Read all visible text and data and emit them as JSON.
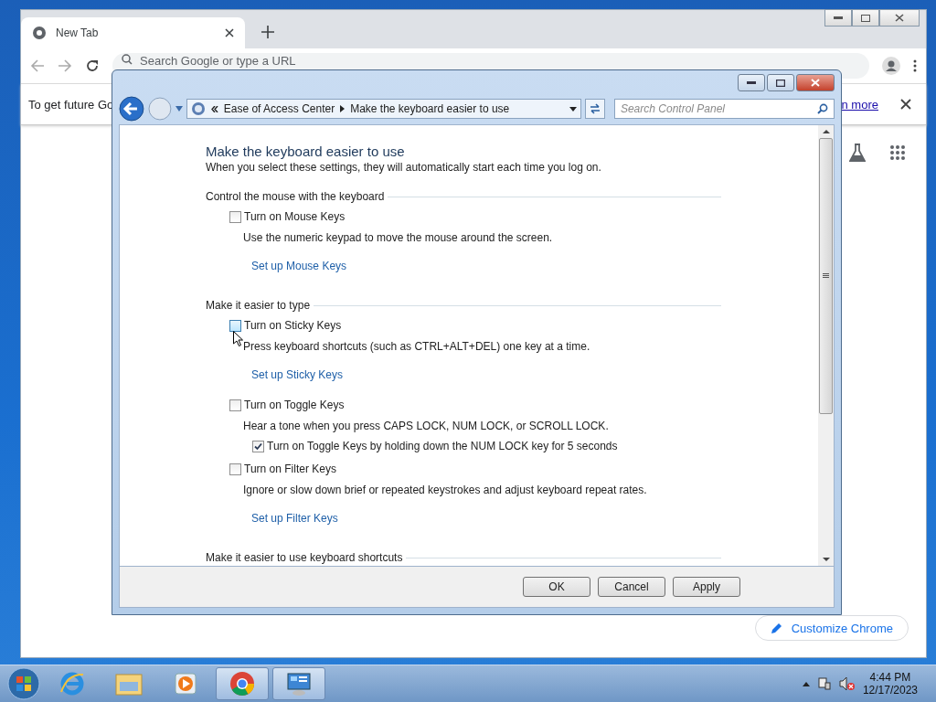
{
  "browser": {
    "tab": {
      "title": "New Tab"
    },
    "omnibox": {
      "placeholder": "Search Google or type a URL"
    },
    "infobar": {
      "text": "To get future Go",
      "link": "n more"
    },
    "customize_button": "Customize Chrome"
  },
  "dialog": {
    "breadcrumb": [
      "Ease of Access Center",
      "Make the keyboard easier to use"
    ],
    "search": {
      "placeholder": "Search Control Panel"
    },
    "title": "Make the keyboard easier to use",
    "subtitle": "When you select these settings, they will automatically start each time you log on.",
    "sections": [
      {
        "heading": "Control the mouse with the keyboard",
        "items": [
          {
            "label": "Turn on Mouse Keys",
            "checked": false,
            "hovered": false,
            "description": "Use the numeric keypad to move the mouse around the screen.",
            "link": "Set up Mouse Keys"
          }
        ]
      },
      {
        "heading": "Make it easier to type",
        "items": [
          {
            "label": "Turn on Sticky Keys",
            "checked": false,
            "hovered": true,
            "description": "Press keyboard shortcuts (such as CTRL+ALT+DEL) one key at a time.",
            "link": "Set up Sticky Keys"
          },
          {
            "label": "Turn on Toggle Keys",
            "checked": false,
            "hovered": false,
            "description": "Hear a tone when you press CAPS LOCK, NUM LOCK, or SCROLL LOCK.",
            "sub": {
              "label": "Turn on Toggle Keys by holding down the NUM LOCK key for 5 seconds",
              "checked": true
            }
          },
          {
            "label": "Turn on Filter Keys",
            "checked": false,
            "hovered": false,
            "description": "Ignore or slow down brief or repeated keystrokes and adjust keyboard repeat rates.",
            "link": "Set up Filter Keys"
          }
        ]
      },
      {
        "heading": "Make it easier to use keyboard shortcuts"
      }
    ],
    "buttons": [
      "OK",
      "Cancel",
      "Apply"
    ]
  },
  "taskbar": {
    "apps": [
      {
        "kind": "ie",
        "open": false
      },
      {
        "kind": "explorer",
        "open": false
      },
      {
        "kind": "media",
        "open": false
      },
      {
        "kind": "chrome",
        "open": true
      },
      {
        "kind": "control",
        "open": true
      }
    ],
    "time": "4:44 PM",
    "date": "12/17/2023"
  }
}
